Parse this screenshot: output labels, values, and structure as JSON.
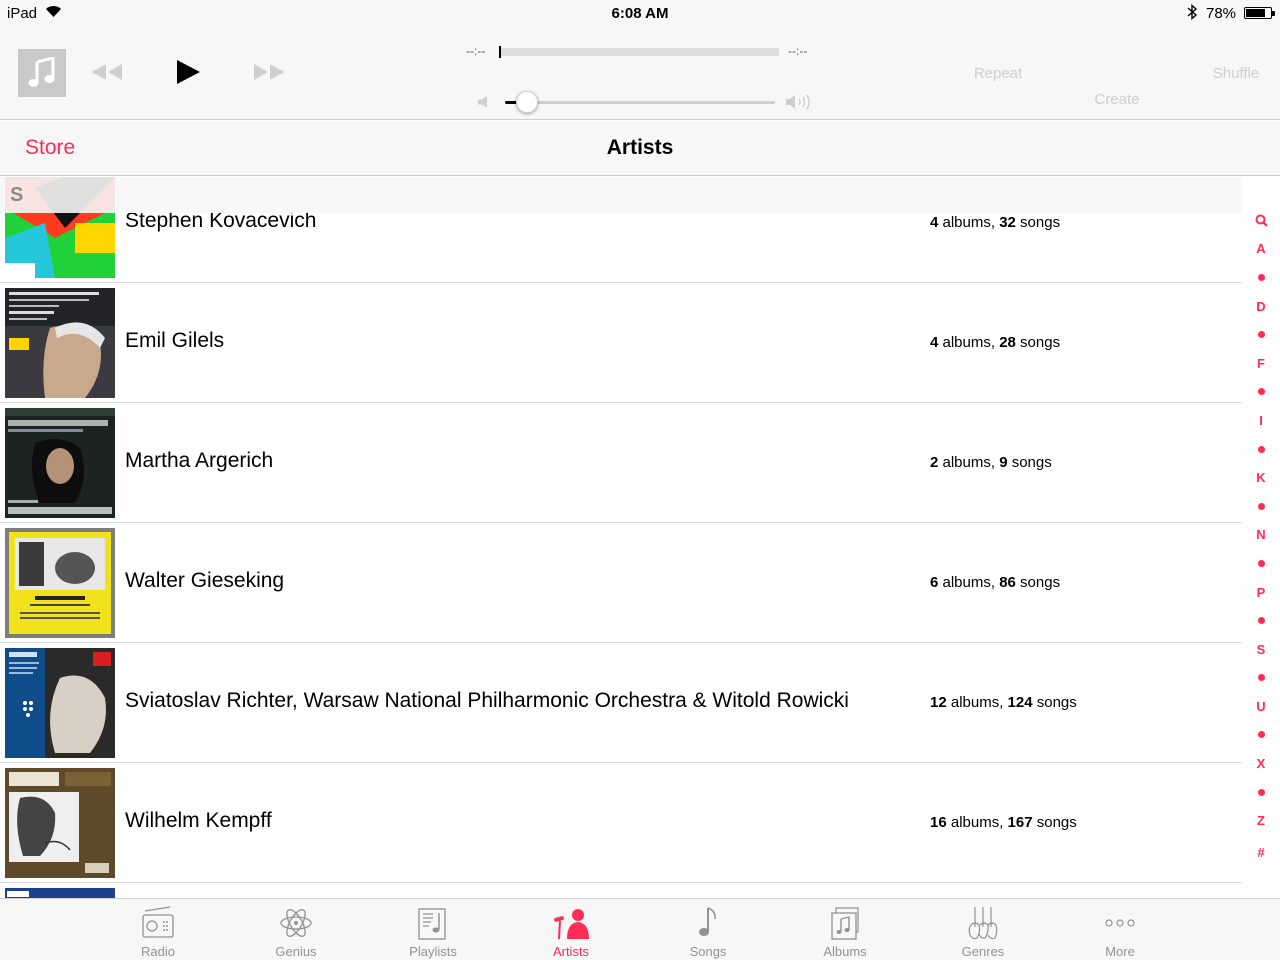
{
  "status_bar": {
    "device": "iPad",
    "time": "6:08 AM",
    "battery_percent": "78%",
    "battery_level": 0.78
  },
  "player": {
    "elapsed": "--:--",
    "remaining": "--:--",
    "progress": 0,
    "volume": 0.08,
    "repeat_label": "Repeat",
    "create_label": "Create",
    "shuffle_label": "Shuffle"
  },
  "nav": {
    "store_label": "Store",
    "title": "Artists"
  },
  "section_header": "S",
  "artists": [
    {
      "name": "Stephen Kovacevich",
      "albums_n": "4",
      "albums_w": " albums, ",
      "songs_n": "32",
      "songs_w": " songs"
    },
    {
      "name": "Emil Gilels",
      "albums_n": "4",
      "albums_w": " albums, ",
      "songs_n": "28",
      "songs_w": " songs"
    },
    {
      "name": "Martha Argerich",
      "albums_n": "2",
      "albums_w": " albums, ",
      "songs_n": "9",
      "songs_w": " songs"
    },
    {
      "name": "Walter Gieseking",
      "albums_n": "6",
      "albums_w": " albums, ",
      "songs_n": "86",
      "songs_w": " songs"
    },
    {
      "name": "Sviatoslav Richter, Warsaw National Philharmonic Orchestra & Witold Rowicki",
      "albums_n": "12",
      "albums_w": " albums, ",
      "songs_n": "124",
      "songs_w": " songs"
    },
    {
      "name": "Wilhelm Kempff",
      "albums_n": "16",
      "albums_w": " albums, ",
      "songs_n": "167",
      "songs_w": " songs"
    },
    {
      "name": "",
      "albums_n": "",
      "albums_w": "",
      "songs_n": "",
      "songs_w": ""
    }
  ],
  "index_labels": [
    "A",
    "D",
    "F",
    "I",
    "K",
    "N",
    "P",
    "S",
    "U",
    "X",
    "Z",
    "#"
  ],
  "tabs": [
    {
      "label": "Radio",
      "icon": "radio-icon"
    },
    {
      "label": "Genius",
      "icon": "genius-atom-icon"
    },
    {
      "label": "Playlists",
      "icon": "playlists-icon"
    },
    {
      "label": "Artists",
      "icon": "artists-icon",
      "active": true
    },
    {
      "label": "Songs",
      "icon": "music-note-icon"
    },
    {
      "label": "Albums",
      "icon": "albums-icon"
    },
    {
      "label": "Genres",
      "icon": "genres-guitar-icon"
    },
    {
      "label": "More",
      "icon": "more-dots-icon"
    }
  ],
  "colors": {
    "accent": "#ff2d55",
    "inactive_tab": "#929292",
    "disabled_control": "#cfcfcf"
  }
}
